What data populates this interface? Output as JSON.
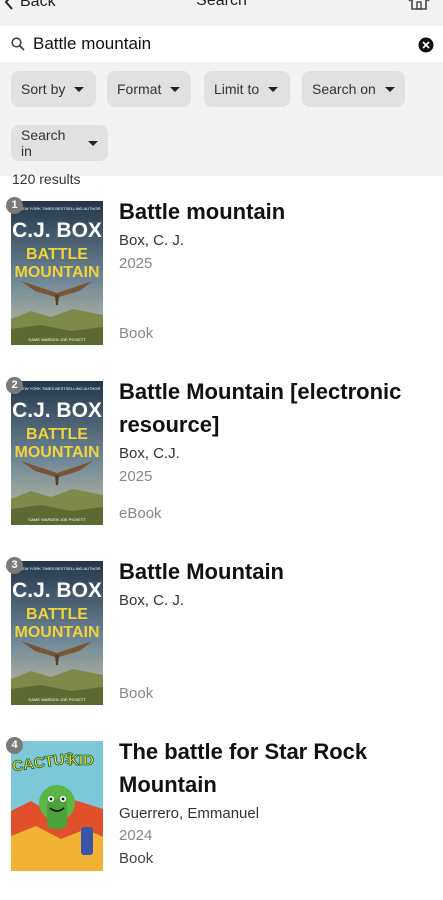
{
  "header": {
    "back_label": "Back",
    "title": "Search"
  },
  "search": {
    "query": "Battle mountain"
  },
  "filters": [
    "Sort by",
    "Format",
    "Limit to",
    "Search on",
    "Search in"
  ],
  "results_count": "120 results",
  "results": [
    {
      "num": "1",
      "title": "Battle mountain",
      "author": "Box, C. J.",
      "year": "2025",
      "format": "Book",
      "cover": {
        "tagline": "#1 NEW YORK TIMES BESTSELLING AUTHOR",
        "author": "C.J. BOX",
        "title_lines": [
          "BATTLE",
          "MOUNTAIN"
        ],
        "footer": "GAME WARDEN JOE PICKETT"
      }
    },
    {
      "num": "2",
      "title": "Battle Mountain [electronic resource]",
      "author": "Box, C.J.",
      "year": "2025",
      "format": "eBook",
      "cover": {
        "tagline": "#1 NEW YORK TIMES BESTSELLING AUTHOR",
        "author": "C.J. BOX",
        "title_lines": [
          "BATTLE",
          "MOUNTAIN"
        ],
        "footer": "GAME WARDEN JOE PICKETT"
      }
    },
    {
      "num": "3",
      "title": "Battle Mountain",
      "author": "Box, C. J.",
      "year": "",
      "format": "Book",
      "cover": {
        "tagline": "#1 NEW YORK TIMES BESTSELLING AUTHOR",
        "author": "C.J. BOX",
        "title_lines": [
          "BATTLE",
          "MOUNTAIN"
        ],
        "footer": "GAME WARDEN JOE PICKETT"
      }
    },
    {
      "num": "4",
      "title": "The battle for Star Rock Mountain",
      "author": "Guerrero, Emmanuel",
      "year": "2024",
      "format": "Book",
      "cover": {
        "title_lines": [
          "CACTUS",
          "KID"
        ]
      }
    }
  ]
}
